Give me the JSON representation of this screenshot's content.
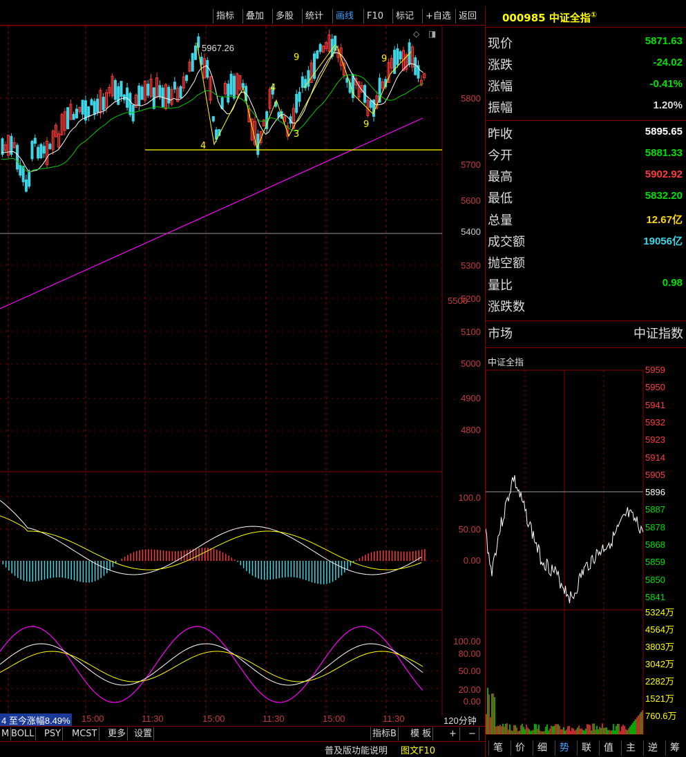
{
  "toolbar": {
    "buttons": [
      "指标",
      "叠加",
      "多股",
      "统计",
      "画线",
      "F10",
      "标记",
      "+自选",
      "返回"
    ],
    "active": "画线"
  },
  "chart": {
    "peak_label": "5967.26",
    "wave_labels": [
      "9",
      "4",
      "3",
      "9",
      "9",
      "4"
    ],
    "price_axis": [
      "5800",
      "5700",
      "5600",
      "5500",
      "5400",
      "5300",
      "5200",
      "5100",
      "5000",
      "4900",
      "4800"
    ],
    "macd_axis": [
      "100.0",
      "50.00",
      "0.00"
    ],
    "kdj_axis": [
      "100.00",
      "80.00",
      "50.00",
      "20.00",
      "0.00"
    ],
    "colors": {
      "up": "#ff3b3b",
      "down": "#3cd6e6",
      "ma5": "#ffffff",
      "ma10": "#ffff00",
      "ma20": "#00cc00",
      "ma60": "#ff00ff",
      "grid": "#8a0000",
      "support": "#ffff00"
    }
  },
  "time_axis": {
    "range_label": "4 至今涨幅8.49%",
    "ticks": [
      "15:00",
      "11:30",
      "15:00",
      "11:30",
      "15:00",
      "11:30"
    ],
    "period": "120分钟"
  },
  "tabs": {
    "left": [
      "M",
      "BOLL",
      "PSY",
      "MCST",
      "更多",
      "设置"
    ],
    "right": [
      "指标B",
      "模 板",
      "+",
      "−"
    ]
  },
  "status": {
    "help": "普及版功能说明",
    "f10": "图文F10"
  },
  "quote": {
    "code": "000985",
    "name": "中证全指",
    "badge": "①",
    "rows": [
      {
        "label": "现价",
        "value": "5871.63",
        "color": "#00e000"
      },
      {
        "label": "涨跌",
        "value": "-24.02",
        "color": "#00e000"
      },
      {
        "label": "涨幅",
        "value": "-0.41%",
        "color": "#00e000"
      },
      {
        "label": "振幅",
        "value": "1.20%",
        "color": "#dddddd"
      },
      {
        "label": "昨收",
        "value": "5895.65",
        "color": "#ffffff"
      },
      {
        "label": "今开",
        "value": "5881.33",
        "color": "#00e000"
      },
      {
        "label": "最高",
        "value": "5902.92",
        "color": "#ff3b3b"
      },
      {
        "label": "最低",
        "value": "5832.20",
        "color": "#00e000"
      },
      {
        "label": "总量",
        "value": "12.67亿",
        "color": "#ffd700"
      },
      {
        "label": "成交额",
        "value": "19056亿",
        "color": "#3cd6e6"
      },
      {
        "label": "抛空额",
        "value": "",
        "color": "#dddddd"
      },
      {
        "label": "量比",
        "value": "0.98",
        "color": "#00e000"
      },
      {
        "label": "涨跌数",
        "value": "",
        "color": "#dddddd"
      }
    ],
    "market_label": "市场",
    "market_value": "中证指数"
  },
  "intraday": {
    "title": "中证全指",
    "price_ticks": [
      "5959",
      "5950",
      "5941",
      "5932",
      "5923",
      "5914",
      "5905",
      "5896",
      "5887",
      "5878",
      "5868",
      "5859",
      "5850",
      "5841"
    ],
    "prev_close": "5896",
    "volume_ticks": [
      "5324万",
      "4564万",
      "3803万",
      "3042万",
      "2282万",
      "1521万",
      "760.6万"
    ]
  },
  "bottom_tabs": [
    "笔",
    "价",
    "细",
    "势",
    "联",
    "值",
    "主",
    "逆",
    "筹"
  ],
  "bottom_active": "势"
}
